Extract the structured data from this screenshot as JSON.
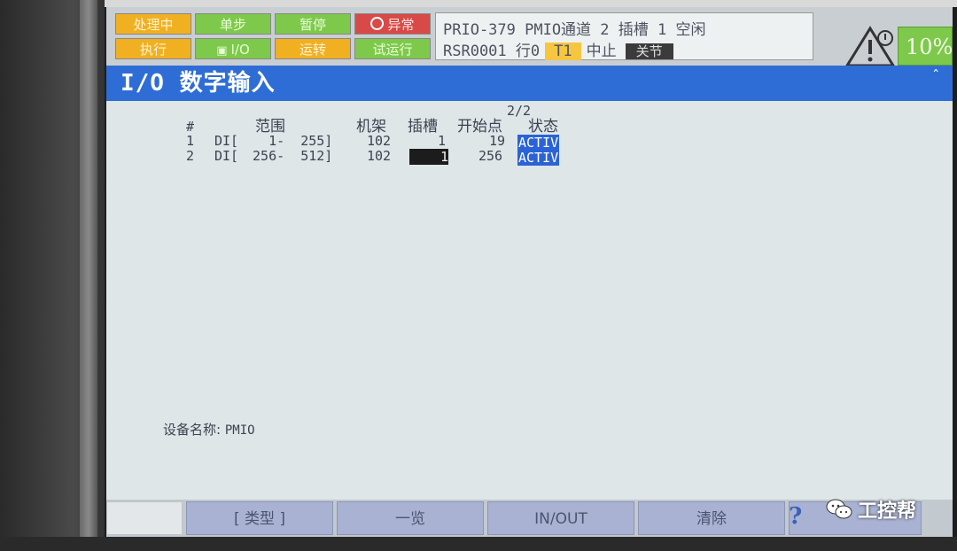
{
  "status": {
    "busy": "处理中",
    "step": "单步",
    "hold": "暂停",
    "fault": "异常",
    "run": "执行",
    "io": "I/O",
    "prod": "运转",
    "test": "试运行"
  },
  "message": {
    "line1": "PRIO-379 PMIO通道 2 插槽 1 空闲",
    "line2_prefix": "RSR0001 行0",
    "mode": "T1",
    "state": "中止",
    "rate_label": "关节"
  },
  "override_pct": "10%",
  "screen_title": "I/O 数字输入",
  "table": {
    "page": "2/2",
    "headers": {
      "num": "#",
      "range": "范围",
      "rack": "机架",
      "slot": "插槽",
      "start": "开始点",
      "status": "状态"
    },
    "rows": [
      {
        "num": "1",
        "type": "DI[",
        "range": "   1-  255]",
        "rack": "102",
        "slot": "1",
        "start": "19",
        "status": "ACTIV"
      },
      {
        "num": "2",
        "type": "DI[",
        "range": " 256-  512]",
        "rack": "102",
        "slot": "1",
        "start": "256",
        "status": "ACTIV"
      }
    ]
  },
  "device": {
    "label": "设备名称:",
    "value": "PMIO"
  },
  "fkeys": [
    "[ 类型 ]",
    "一览",
    "IN/OUT",
    "清除",
    ""
  ],
  "watermark": "工控帮",
  "colors": {
    "accent": "#2f6dd6",
    "status_orange": "#f1b021",
    "status_green": "#7ec94b",
    "status_red": "#d84a47"
  }
}
